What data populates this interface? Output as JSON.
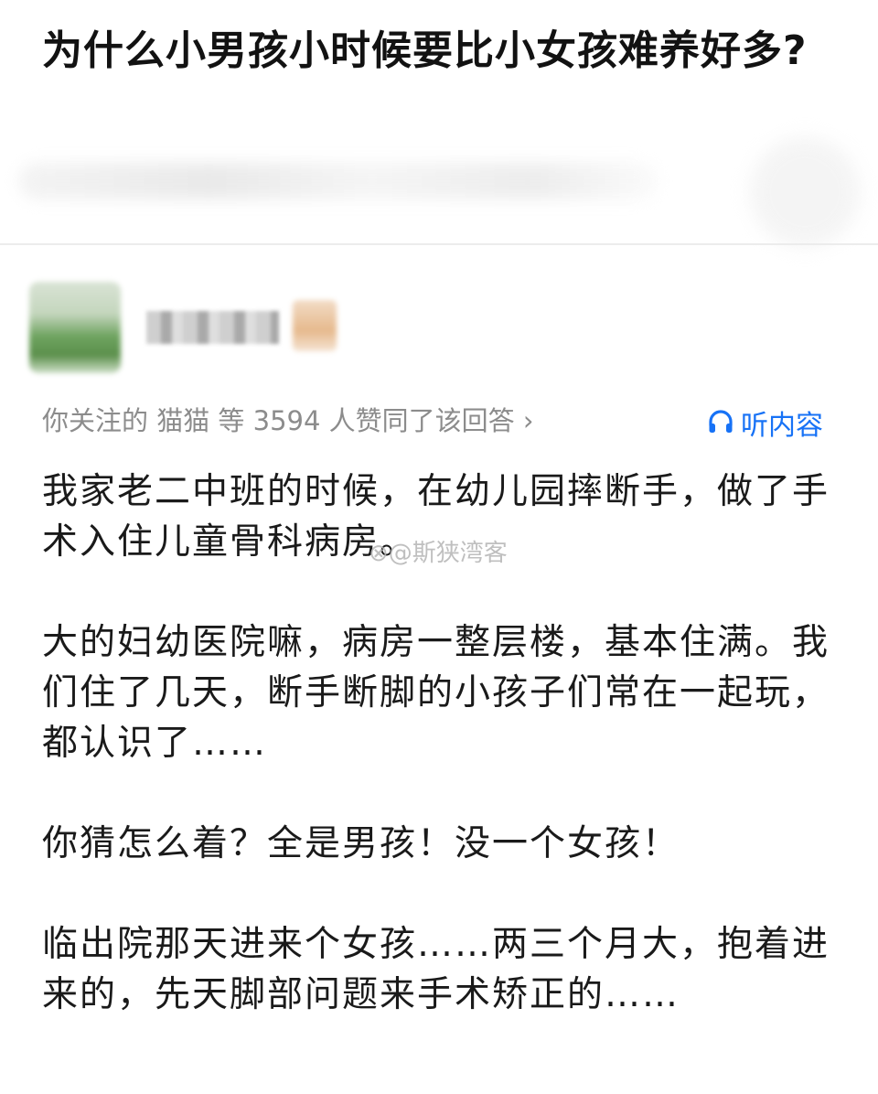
{
  "question": {
    "title": "为什么小男孩小时候要比小女孩难养好多?"
  },
  "answer_meta": {
    "followers_text": "你关注的 猫猫 等 3594 人赞同了该回答 ›",
    "listen_label": "听内容",
    "accent_color": "#1772f6",
    "listen_icon": "headphones-icon"
  },
  "answer": {
    "paragraphs": [
      "我家老二中班的时候，在幼儿园摔断手，做了手术入住儿童骨科病房。",
      "大的妇幼医院嘛，病房一整层楼，基本住满。我们住了几天，断手断脚的小孩子们常在一起玩，都认识了……",
      "你猜怎么着？全是男孩！没一个女孩！",
      "临出院那天进来个女孩……两三个月大，抱着进来的，先天脚部问题来手术矫正的……"
    ]
  },
  "watermark": {
    "text": "⊗@斯狭湾客"
  }
}
